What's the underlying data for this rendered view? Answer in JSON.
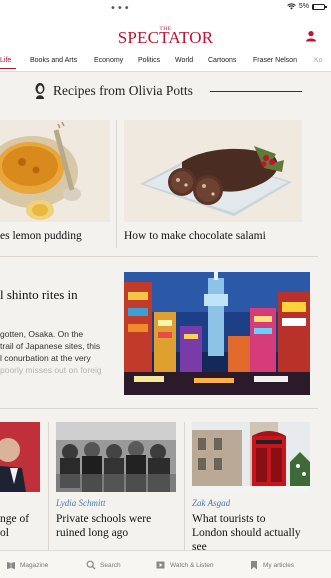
{
  "status": {
    "dots": "•••",
    "battery": "5%",
    "battery_fraction": 0.05
  },
  "header": {
    "logo_small": "THE",
    "logo": "SPECTATOR",
    "nav": [
      "Life",
      "Books and Arts",
      "Economy",
      "Politics",
      "World",
      "Cartoons",
      "Fraser Nelson",
      "Ko"
    ],
    "active_nav": "Life"
  },
  "section": {
    "title": "Recipes from Olivia Potts"
  },
  "recipes": [
    {
      "caption": "es lemon pudding"
    },
    {
      "caption": "How to make chocolate salami"
    }
  ],
  "feature": {
    "title": "l shinto rites in",
    "excerpt": [
      "gotten, Osaka. On the",
      "trail of Japanese sites, this",
      "l conurbation at the very",
      "poorly misses out on foreig"
    ]
  },
  "articles": [
    {
      "author": "",
      "caption": [
        "nge of",
        "ol"
      ]
    },
    {
      "author": "Lydia Schmitt",
      "caption": [
        "Private schools were",
        "ruined long ago"
      ]
    },
    {
      "author": "Zak Asgad",
      "caption": [
        "What tourists to",
        "London should actually",
        "see"
      ]
    }
  ],
  "tabs": [
    {
      "label": "Magazine",
      "icon": "book-icon"
    },
    {
      "label": "Search",
      "icon": "search-icon"
    },
    {
      "label": "Watch & Listen",
      "icon": "play-icon"
    },
    {
      "label": "My articles",
      "icon": "bookmark-icon"
    }
  ],
  "colors": {
    "brand": "#c8102e",
    "author": "#4a7bb0",
    "background": "#f4f2ee"
  }
}
